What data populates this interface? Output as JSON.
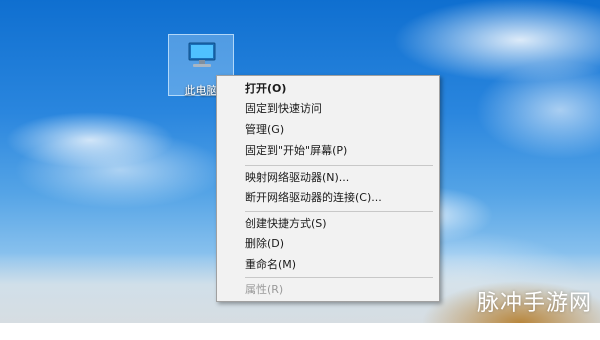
{
  "desktop": {
    "icon": {
      "label": "此电脑",
      "icon": "computer-icon"
    }
  },
  "context_menu": {
    "items": [
      {
        "label": "打开(O)",
        "bold": true,
        "disabled": false
      },
      {
        "label": "固定到快速访问",
        "bold": false,
        "disabled": false
      },
      {
        "label": "管理(G)",
        "bold": false,
        "disabled": false
      },
      {
        "label": "固定到\"开始\"屏幕(P)",
        "bold": false,
        "disabled": false
      },
      {
        "label": "映射网络驱动器(N)...",
        "bold": false,
        "disabled": false
      },
      {
        "label": "断开网络驱动器的连接(C)...",
        "bold": false,
        "disabled": false
      },
      {
        "label": "创建快捷方式(S)",
        "bold": false,
        "disabled": false
      },
      {
        "label": "删除(D)",
        "bold": false,
        "disabled": false
      },
      {
        "label": "重命名(M)",
        "bold": false,
        "disabled": false
      },
      {
        "label": "属性(R)",
        "bold": false,
        "disabled": true
      }
    ]
  },
  "watermark": {
    "text": "脉冲手游网"
  }
}
